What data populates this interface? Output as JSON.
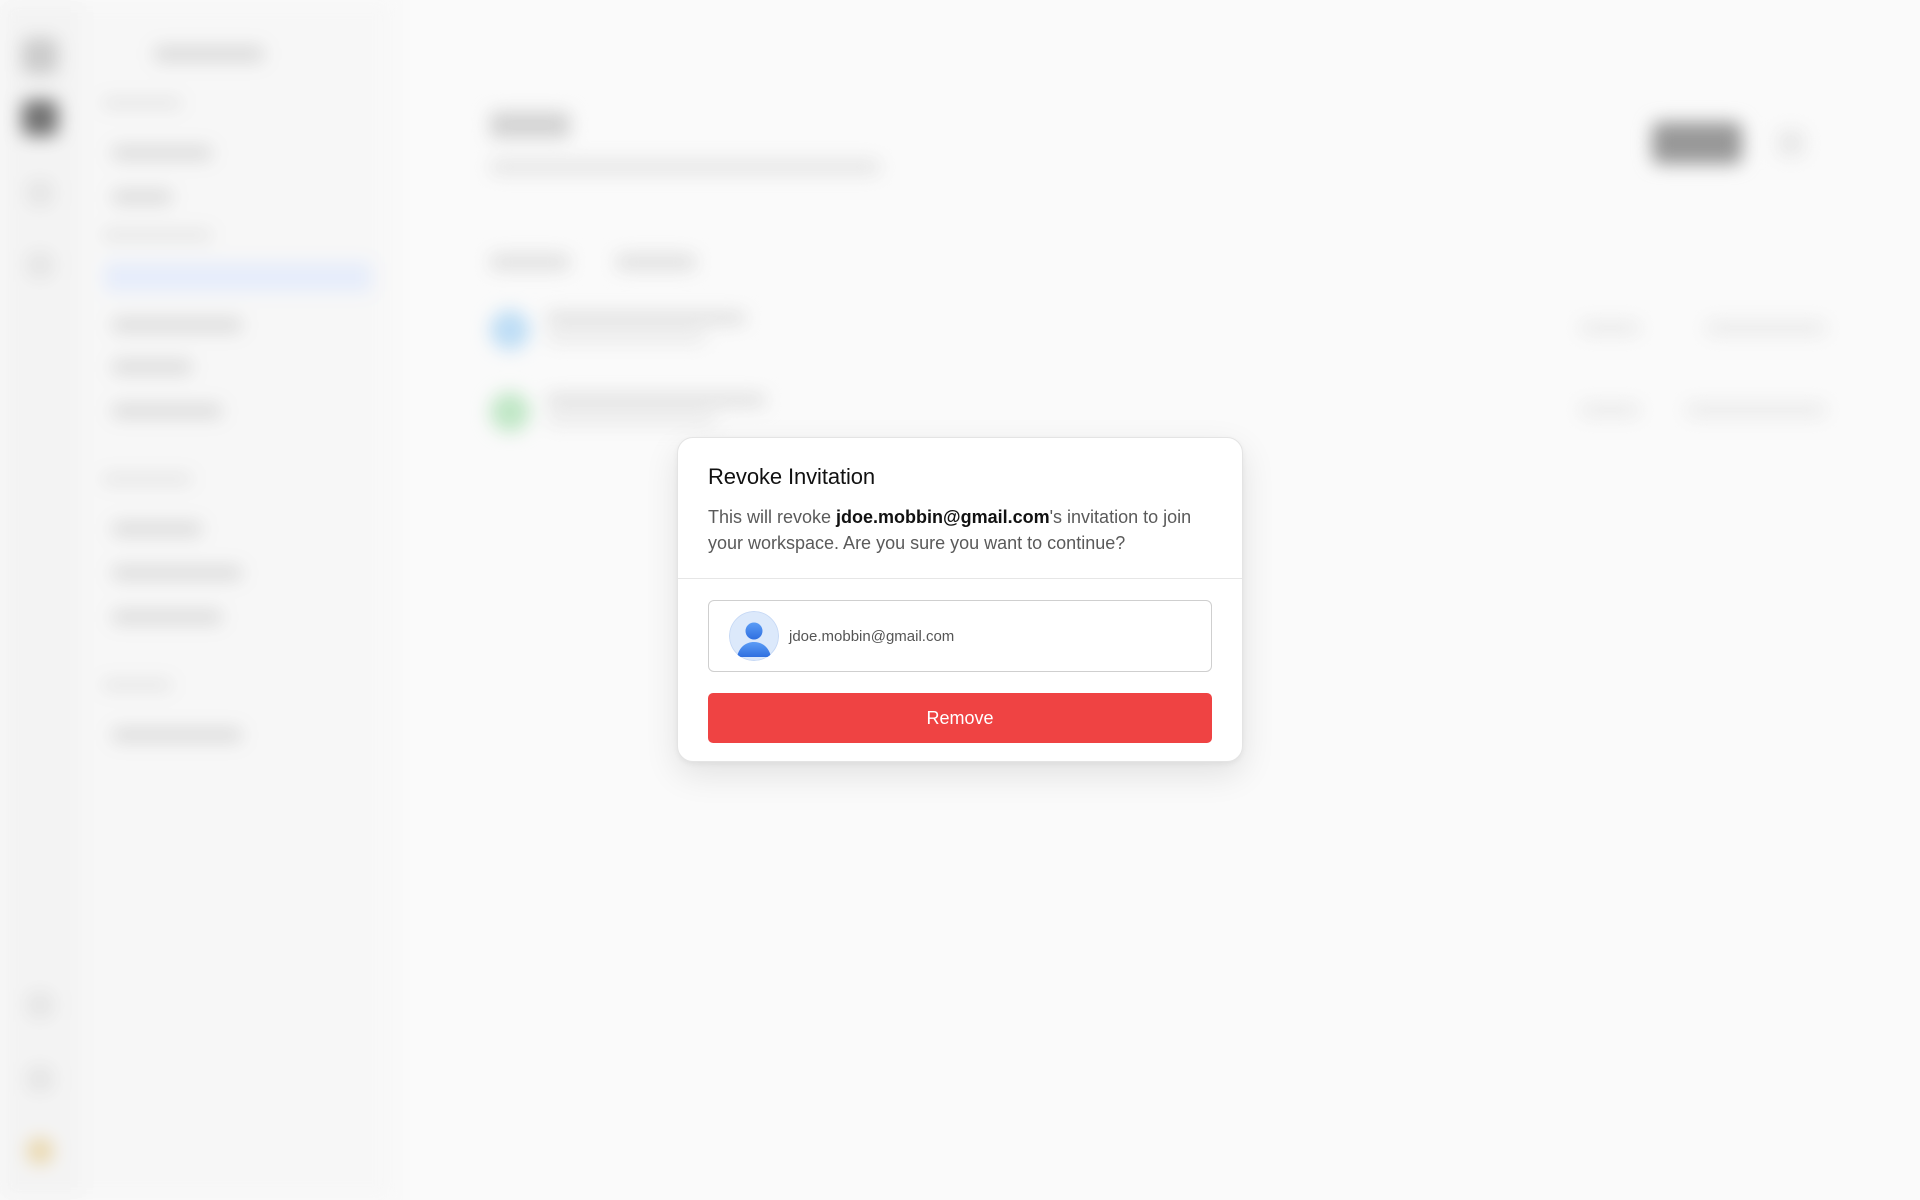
{
  "dialog": {
    "title": "Revoke Invitation",
    "description_prefix": "This will revoke ",
    "description_email": "jdoe.mobbin@gmail.com",
    "description_suffix": "'s invitation to join your workspace. Are you sure you want to continue?",
    "invitee_email": "jdoe.mobbin@gmail.com",
    "remove_label": "Remove",
    "avatar_icon": "person-avatar-icon"
  },
  "colors": {
    "danger": "#ef4343",
    "avatar_blue": "#3b82f6",
    "background": "#fafafa"
  }
}
